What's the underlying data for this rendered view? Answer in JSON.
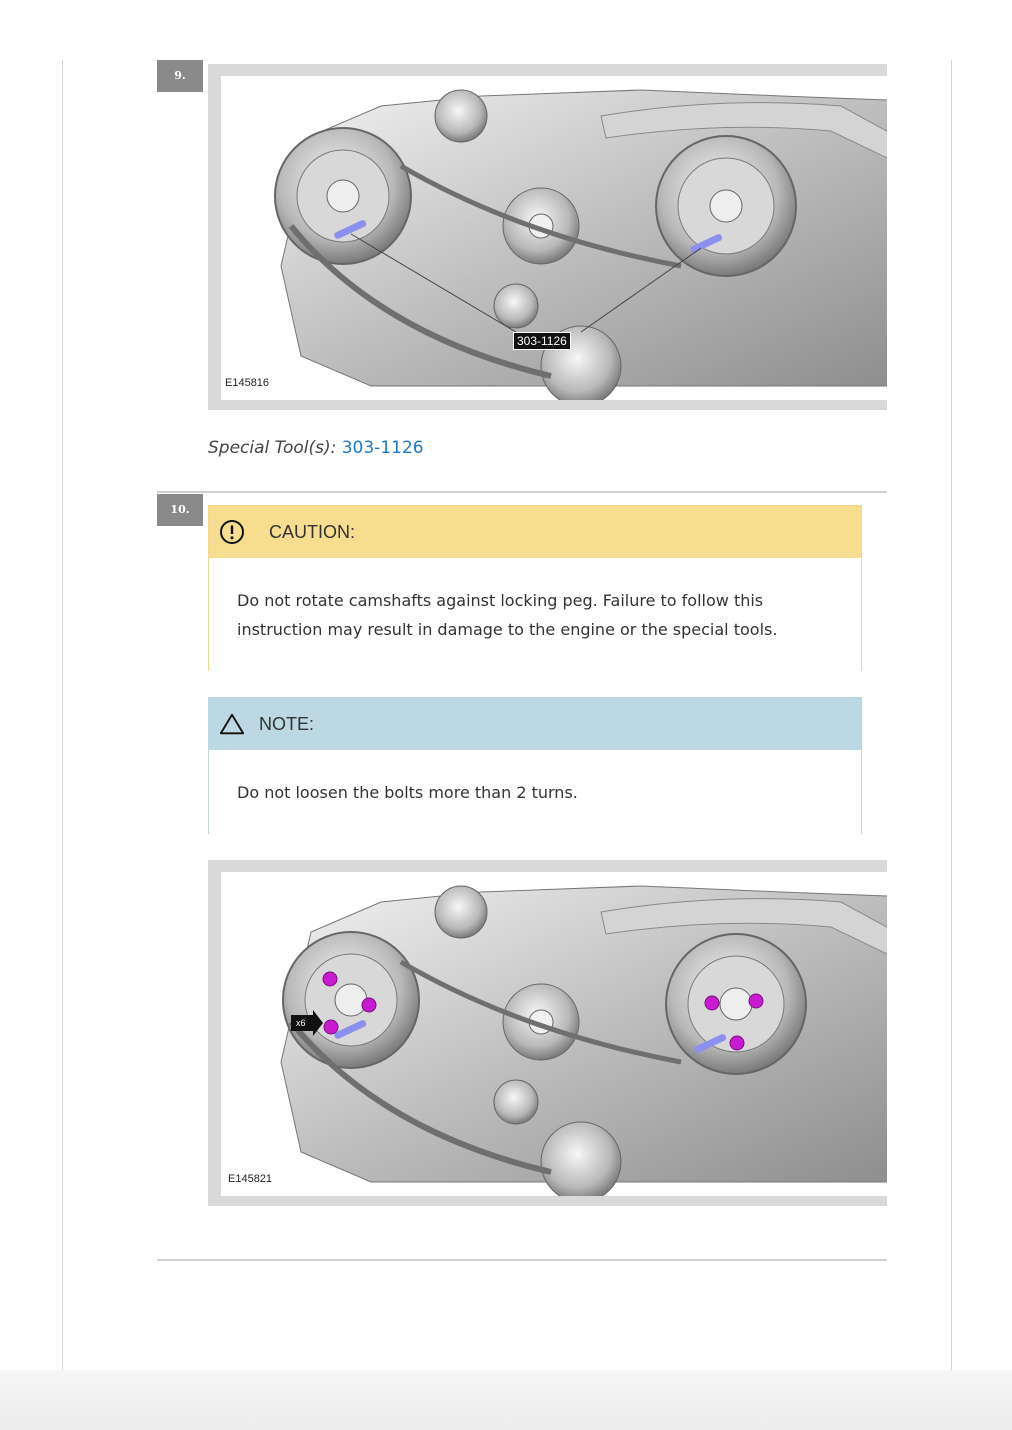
{
  "step9": {
    "number": "9.",
    "figure_id": "E145816",
    "callout_label": "303-1126",
    "special_tools_label": "Special Tool(s):",
    "special_tools_link": "303-1126"
  },
  "step10": {
    "number": "10.",
    "caution": {
      "title": "CAUTION:",
      "text": "Do not rotate camshafts against locking peg. Failure to follow this instruction may result in damage to the engine or the special tools."
    },
    "note": {
      "title": "NOTE:",
      "text": "Do not loosen the bolts more than 2 turns."
    },
    "figure_id": "E145821",
    "quantity_label": "x6"
  },
  "colors": {
    "link": "#1a7ac8",
    "caution_header": "#f7dd8f",
    "note_header": "#bcd8e3",
    "step_badge": "#8a8a8a",
    "bolt_marker": "#c81bd0"
  }
}
